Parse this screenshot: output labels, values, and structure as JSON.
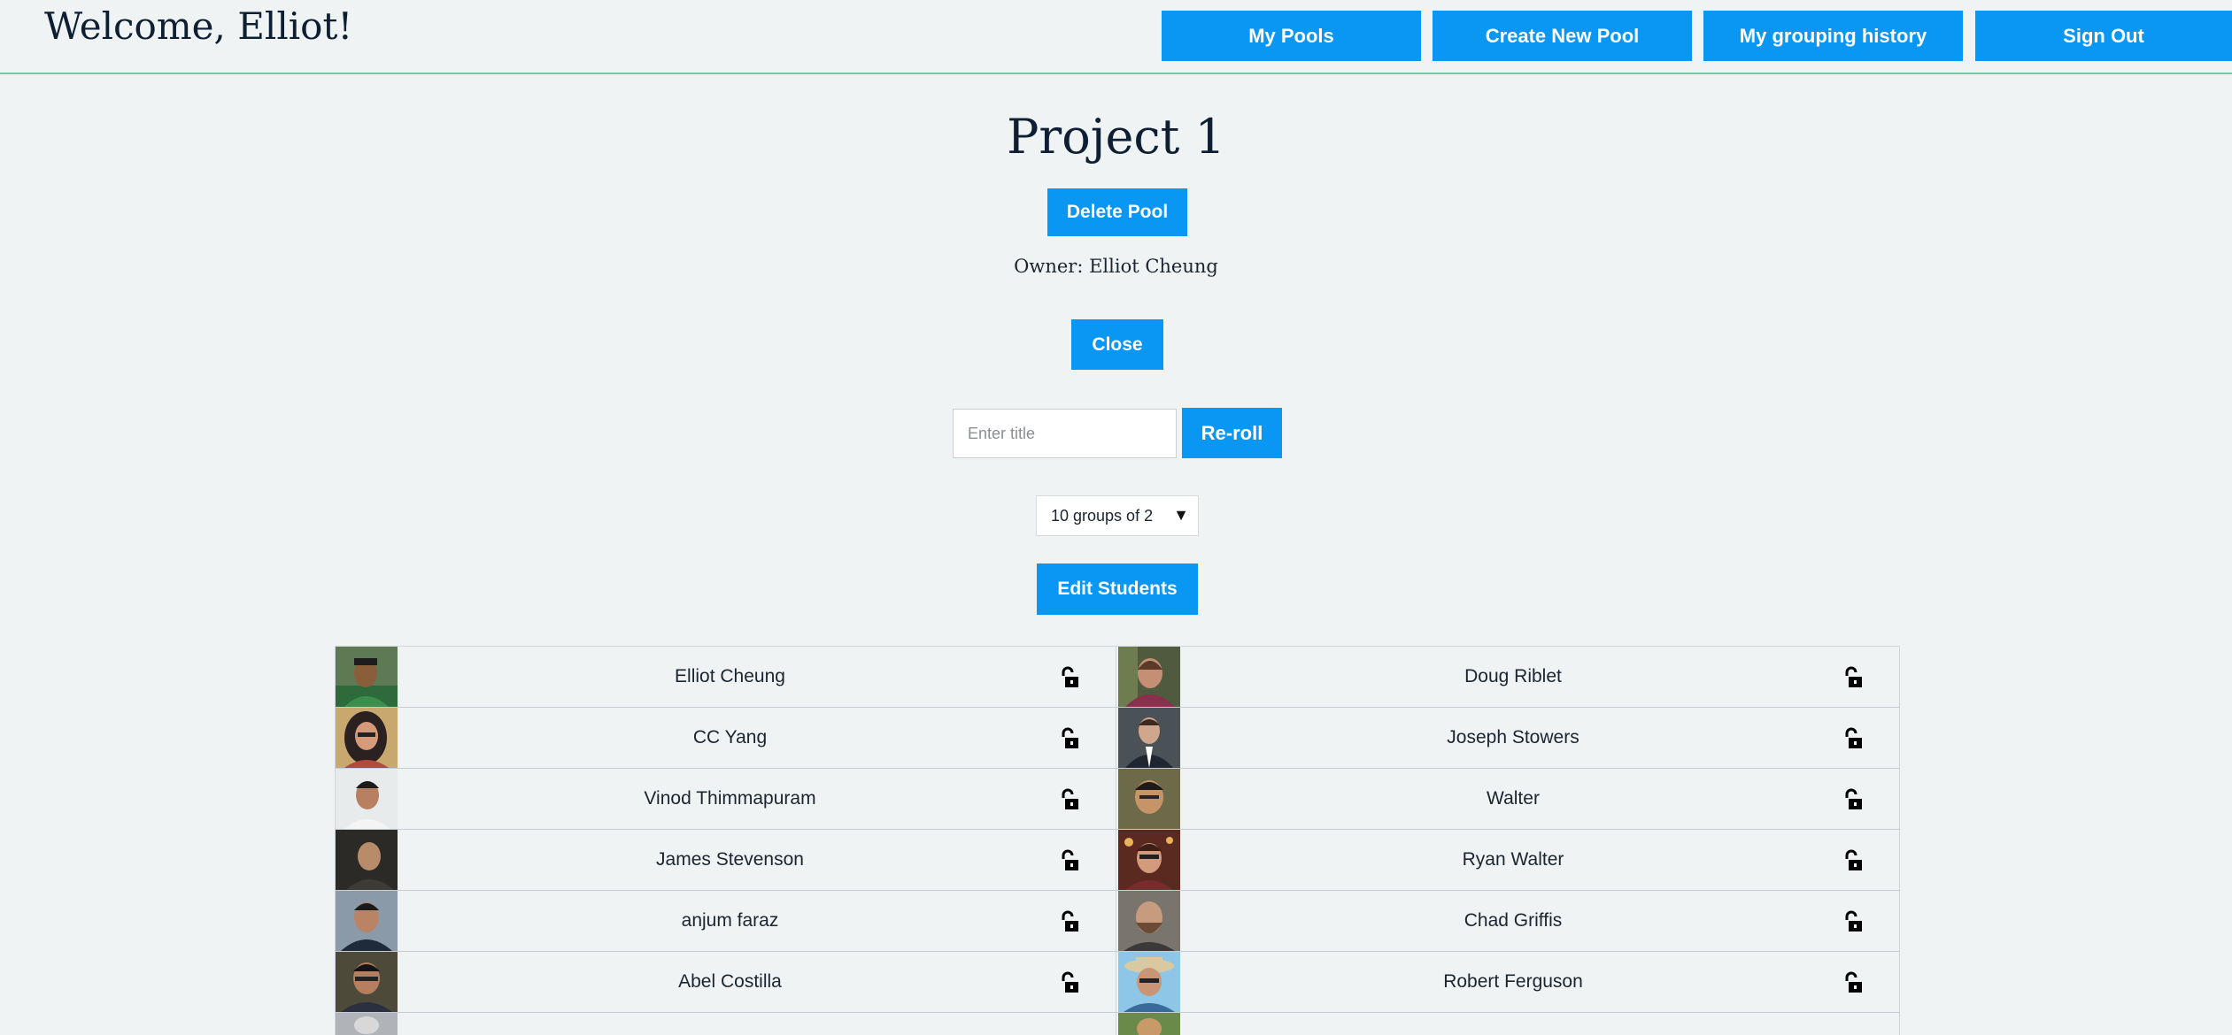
{
  "header": {
    "welcome": "Welcome, Elliot!",
    "nav": [
      {
        "label": "My Pools"
      },
      {
        "label": "Create New Pool"
      },
      {
        "label": "My grouping history"
      },
      {
        "label": "Sign Out"
      }
    ]
  },
  "pool": {
    "title": "Project 1",
    "delete_label": "Delete Pool",
    "owner_text": "Owner: Elliot Cheung",
    "close_label": "Close",
    "title_input": {
      "value": "",
      "placeholder": "Enter title"
    },
    "reroll_label": "Re-roll",
    "group_select": {
      "selected": "10 groups of 2"
    },
    "edit_students_label": "Edit Students"
  },
  "roster": {
    "lock_icon": "unlocked-padlock-icon",
    "rows": [
      [
        {
          "name": "Elliot Cheung"
        },
        {
          "name": "Doug Riblet"
        }
      ],
      [
        {
          "name": "CC Yang"
        },
        {
          "name": "Joseph Stowers"
        }
      ],
      [
        {
          "name": "Vinod Thimmapuram"
        },
        {
          "name": "Walter"
        }
      ],
      [
        {
          "name": "James Stevenson"
        },
        {
          "name": "Ryan Walter"
        }
      ],
      [
        {
          "name": "anjum faraz"
        },
        {
          "name": "Chad Griffis"
        }
      ],
      [
        {
          "name": "Abel Costilla"
        },
        {
          "name": "Robert Ferguson"
        }
      ],
      [
        {
          "name": ""
        },
        {
          "name": ""
        }
      ]
    ]
  },
  "colors": {
    "accent": "#0a96f3",
    "background": "#eff3f4",
    "header_rule": "#7cc39e"
  }
}
